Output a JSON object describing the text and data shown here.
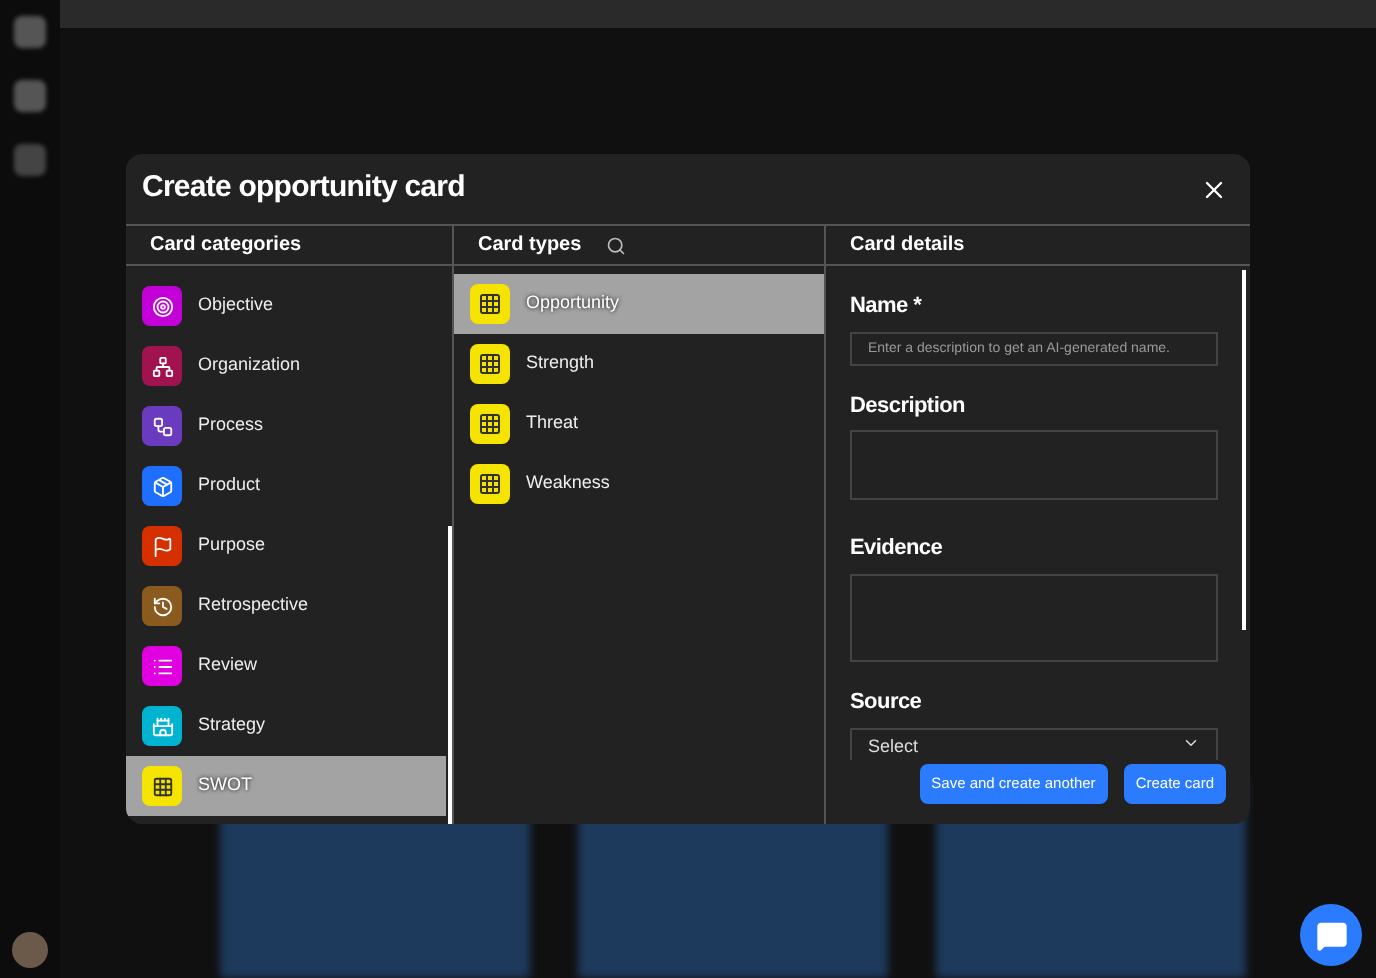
{
  "dialog": {
    "title": "Create opportunity card"
  },
  "columns": {
    "categories": "Card categories",
    "types": "Card types",
    "details": "Card details"
  },
  "categories": [
    {
      "label": "Objective",
      "color": "#c400d8",
      "selected": false
    },
    {
      "label": "Organization",
      "color": "#a0134f",
      "selected": false
    },
    {
      "label": "Process",
      "color": "#6a3bbf",
      "selected": false
    },
    {
      "label": "Product",
      "color": "#1f6fff",
      "selected": false
    },
    {
      "label": "Purpose",
      "color": "#d63000",
      "selected": false
    },
    {
      "label": "Retrospective",
      "color": "#8a5a1e",
      "selected": false
    },
    {
      "label": "Review",
      "color": "#e000e0",
      "selected": false
    },
    {
      "label": "Strategy",
      "color": "#00b3d1",
      "selected": false
    },
    {
      "label": "SWOT",
      "color": "#f5e400",
      "selected": true
    }
  ],
  "types": [
    {
      "label": "Opportunity",
      "selected": true
    },
    {
      "label": "Strength",
      "selected": false
    },
    {
      "label": "Threat",
      "selected": false
    },
    {
      "label": "Weakness",
      "selected": false
    }
  ],
  "details": {
    "name_label": "Name *",
    "name_placeholder": "Enter a description to get an AI-generated name.",
    "description_label": "Description",
    "evidence_label": "Evidence",
    "source_label": "Source",
    "source_value": "Select"
  },
  "buttons": [
    "Save and create another",
    "Create card"
  ]
}
